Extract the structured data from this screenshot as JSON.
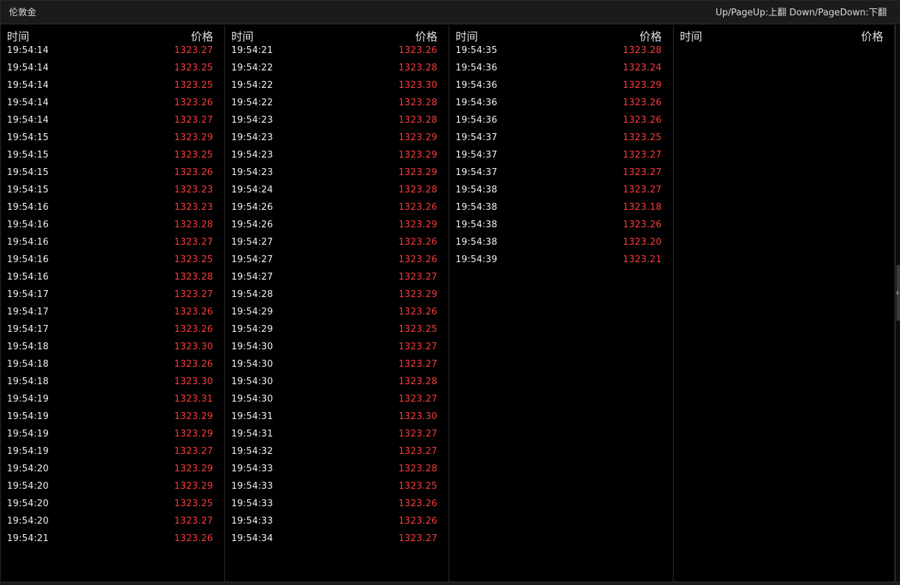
{
  "window": {
    "title": "伦敦金",
    "hint": "Up/PageUp:上翻 Down/PageDown:下翻"
  },
  "columns_header": {
    "time": "时间",
    "price": "价格"
  },
  "columns": [
    [
      {
        "t": "19:54:14",
        "p": "1323.27"
      },
      {
        "t": "19:54:14",
        "p": "1323.25"
      },
      {
        "t": "19:54:14",
        "p": "1323.25"
      },
      {
        "t": "19:54:14",
        "p": "1323.26"
      },
      {
        "t": "19:54:14",
        "p": "1323.27"
      },
      {
        "t": "19:54:15",
        "p": "1323.29"
      },
      {
        "t": "19:54:15",
        "p": "1323.25"
      },
      {
        "t": "19:54:15",
        "p": "1323.26"
      },
      {
        "t": "19:54:15",
        "p": "1323.23"
      },
      {
        "t": "19:54:16",
        "p": "1323.23"
      },
      {
        "t": "19:54:16",
        "p": "1323.28"
      },
      {
        "t": "19:54:16",
        "p": "1323.27"
      },
      {
        "t": "19:54:16",
        "p": "1323.25"
      },
      {
        "t": "19:54:16",
        "p": "1323.28"
      },
      {
        "t": "19:54:17",
        "p": "1323.27"
      },
      {
        "t": "19:54:17",
        "p": "1323.26"
      },
      {
        "t": "19:54:17",
        "p": "1323.26"
      },
      {
        "t": "19:54:18",
        "p": "1323.30"
      },
      {
        "t": "19:54:18",
        "p": "1323.26"
      },
      {
        "t": "19:54:18",
        "p": "1323.30"
      },
      {
        "t": "19:54:19",
        "p": "1323.31"
      },
      {
        "t": "19:54:19",
        "p": "1323.29"
      },
      {
        "t": "19:54:19",
        "p": "1323.29"
      },
      {
        "t": "19:54:19",
        "p": "1323.27"
      },
      {
        "t": "19:54:20",
        "p": "1323.29"
      },
      {
        "t": "19:54:20",
        "p": "1323.29"
      },
      {
        "t": "19:54:20",
        "p": "1323.25"
      },
      {
        "t": "19:54:20",
        "p": "1323.27"
      },
      {
        "t": "19:54:21",
        "p": "1323.26"
      }
    ],
    [
      {
        "t": "19:54:21",
        "p": "1323.26"
      },
      {
        "t": "19:54:22",
        "p": "1323.28"
      },
      {
        "t": "19:54:22",
        "p": "1323.30"
      },
      {
        "t": "19:54:22",
        "p": "1323.28"
      },
      {
        "t": "19:54:23",
        "p": "1323.28"
      },
      {
        "t": "19:54:23",
        "p": "1323.29"
      },
      {
        "t": "19:54:23",
        "p": "1323.29"
      },
      {
        "t": "19:54:23",
        "p": "1323.29"
      },
      {
        "t": "19:54:24",
        "p": "1323.28"
      },
      {
        "t": "19:54:26",
        "p": "1323.26"
      },
      {
        "t": "19:54:26",
        "p": "1323.29"
      },
      {
        "t": "19:54:27",
        "p": "1323.26"
      },
      {
        "t": "19:54:27",
        "p": "1323.26"
      },
      {
        "t": "19:54:27",
        "p": "1323.27"
      },
      {
        "t": "19:54:28",
        "p": "1323.29"
      },
      {
        "t": "19:54:29",
        "p": "1323.26"
      },
      {
        "t": "19:54:29",
        "p": "1323.25"
      },
      {
        "t": "19:54:30",
        "p": "1323.27"
      },
      {
        "t": "19:54:30",
        "p": "1323.27"
      },
      {
        "t": "19:54:30",
        "p": "1323.28"
      },
      {
        "t": "19:54:30",
        "p": "1323.27"
      },
      {
        "t": "19:54:31",
        "p": "1323.30"
      },
      {
        "t": "19:54:31",
        "p": "1323.27"
      },
      {
        "t": "19:54:32",
        "p": "1323.27"
      },
      {
        "t": "19:54:33",
        "p": "1323.28"
      },
      {
        "t": "19:54:33",
        "p": "1323.25"
      },
      {
        "t": "19:54:33",
        "p": "1323.26"
      },
      {
        "t": "19:54:33",
        "p": "1323.26"
      },
      {
        "t": "19:54:34",
        "p": "1323.27"
      }
    ],
    [
      {
        "t": "19:54:35",
        "p": "1323.28"
      },
      {
        "t": "19:54:36",
        "p": "1323.24"
      },
      {
        "t": "19:54:36",
        "p": "1323.29"
      },
      {
        "t": "19:54:36",
        "p": "1323.26"
      },
      {
        "t": "19:54:36",
        "p": "1323.26"
      },
      {
        "t": "19:54:37",
        "p": "1323.25"
      },
      {
        "t": "19:54:37",
        "p": "1323.27"
      },
      {
        "t": "19:54:37",
        "p": "1323.27"
      },
      {
        "t": "19:54:38",
        "p": "1323.27"
      },
      {
        "t": "19:54:38",
        "p": "1323.18"
      },
      {
        "t": "19:54:38",
        "p": "1323.26"
      },
      {
        "t": "19:54:38",
        "p": "1323.20"
      },
      {
        "t": "19:54:39",
        "p": "1323.21"
      }
    ],
    []
  ],
  "colors": {
    "price": "#ff3b3b",
    "time": "#f2f2f2",
    "background": "#000000"
  }
}
